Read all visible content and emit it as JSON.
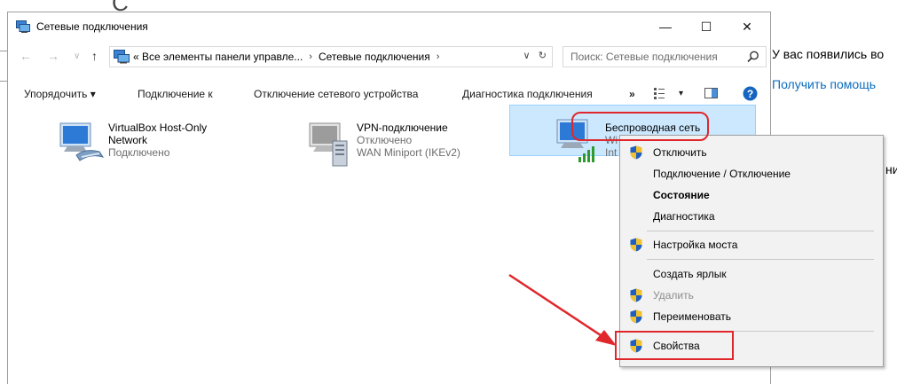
{
  "background": {
    "heading_glyph": "С",
    "line1_text": "У вас появились во",
    "help_link": "Получить помощь",
    "line3_text": "ни"
  },
  "window": {
    "title": "Сетевые подключения",
    "controls": {
      "minimize": "—",
      "maximize": "☐",
      "close": "✕"
    }
  },
  "navigation": {
    "back": "←",
    "forward": "→",
    "recent": "∨",
    "up": "↑",
    "breadcrumbs": [
      "« Все элементы панели управле...",
      "Сетевые подключения"
    ],
    "separator": "›",
    "history_dropdown": "∨",
    "refresh": "↻",
    "search_placeholder": "Поиск: Сетевые подключения"
  },
  "toolbar": {
    "organize": "Упорядочить ▾",
    "connect_to": "Подключение к",
    "disable_device": "Отключение сетевого устройства",
    "diagnose": "Диагностика подключения",
    "more": "»",
    "view_dropdown": "▾"
  },
  "connections": [
    {
      "name_line1": "VirtualBox Host-Only",
      "name_line2": "Network",
      "status": "Подключено"
    },
    {
      "name": "VPN-подключение",
      "status": "Отключено",
      "device": "WAN Miniport (IKEv2)"
    },
    {
      "name": "Беспроводная сеть",
      "status_partial": "Wi",
      "device_partial": "Int"
    }
  ],
  "context_menu": {
    "items": [
      {
        "label": "Отключить",
        "shield": true
      },
      {
        "label": "Подключение / Отключение",
        "shield": false
      },
      {
        "label": "Состояние",
        "shield": false,
        "bold": true
      },
      {
        "label": "Диагностика",
        "shield": false
      },
      {
        "label": "Настройка моста",
        "shield": true
      },
      {
        "label": "Создать ярлык",
        "shield": false
      },
      {
        "label": "Удалить",
        "shield": true,
        "disabled": true
      },
      {
        "label": "Переименовать",
        "shield": true
      },
      {
        "label": "Свойства",
        "shield": true
      }
    ]
  },
  "colors": {
    "selection_bg": "#cce8ff",
    "selection_border": "#99d1ff",
    "annotation_red": "#e0272c",
    "link_blue": "#0a6cc1",
    "help_blue": "#1565c0"
  }
}
